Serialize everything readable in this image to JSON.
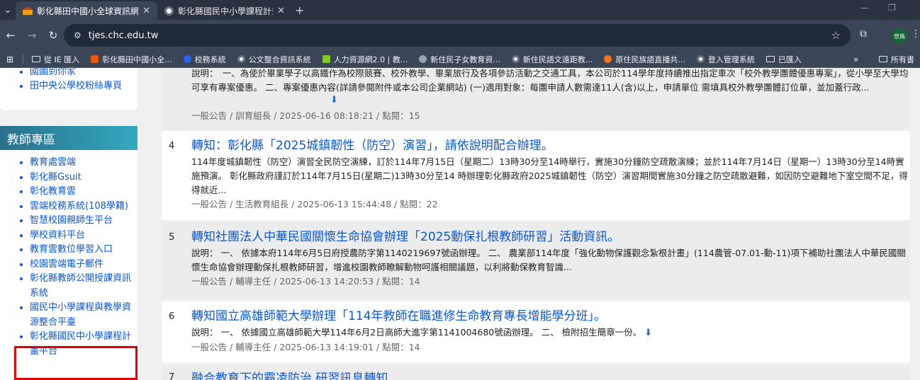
{
  "browser": {
    "tabs": [
      {
        "title": "彰化縣田中國小全球資訊網",
        "active": true
      },
      {
        "title": "彰化縣國民中小學課程計畫平台",
        "active": false
      }
    ],
    "address": "tjes.chc.edu.tw",
    "profile_label": "世鳥",
    "bookmarks": [
      "從 IE 匯入",
      "彰化縣田中國小全...",
      "校務系統",
      "公文整合資訊系統",
      "人力資源網2.0 | 教...",
      "新住民子女教育資...",
      "新住民語文遠距教...",
      "原住民族語直播共...",
      "登入管理系統",
      "已匯入"
    ],
    "bookmarks_more": "»",
    "all_bookmarks": "所有書"
  },
  "sidebar": {
    "top_items": [
      "國圖到你家",
      "田中央公學校粉絲專頁"
    ],
    "section_title": "教師專區",
    "items": [
      "教育處雲端",
      "彰化縣Gsuit",
      "彰化教育雲",
      "雲端校務系統(108學籍)",
      "智慧校園親師生平台",
      "學校資料平台",
      "教育雲數位學習入口",
      "校園雲端電子郵件",
      "彰化縣教師公開授課資訊系統",
      "國民中小學課程與教學資源整合平臺",
      "彰化縣國民中小學課程計畫平台"
    ]
  },
  "posts": [
    {
      "num": "",
      "title": "",
      "desc": "說明：　一、為使於畢業學子以高鐵作為校際競賽、校外教學、畢業旅行及各項參訪活動之交通工具，本公司於114學年度持續推出指定車次「校外教學團體優惠專案」，從小學至大學均可享有專案優惠。 二、專案優惠內容(詳請參閱附件或本公司企業網站) (一)適用對象：每團申請人數需達11人(含)以上，申請單位 需填具校外教學團體訂位單，並加蓋行政...",
      "meta": "一般公告 / 訓育組長 / 2025-06-16 08:18:21 / 點閱：15",
      "download": true
    },
    {
      "num": "4",
      "title": "轉知：彰化縣「2025城鎮韌性（防空）演習」，請依說明配合辦理。",
      "desc": "114年度城鎮韌性（防空）演習全民防空演練，訂於114年7月15日（星期二）13時30分至14時舉行，實施30分鐘防空疏散演練；並於114年7月14日（星期一）13時30分至14時實施預演。 彰化縣政府謹訂於114年7月15日(星期二)13時30分至14 時辦理彰化縣政府2025城鎮韌性（防空）演習期間實施30分鐘之防空疏散避難，如因防空避難地下室空間不足，得得就近...",
      "meta": "一般公告 / 生活教育組長 / 2025-06-13 15:44:48 / 點閱：22",
      "download": false
    },
    {
      "num": "5",
      "title": "轉知社團法人中華民國關懷生命協會辦理「2025動保扎根教師研習」活動資訊。",
      "desc": "說明：  一、 依據本府114年6月5日府授農防字第1140219697號函辦理。 二、 農業部114年度「強化動物保護觀念紮根計畫」(114農管-07.01-動-11)項下補助社團法人中華民國關懷生命協會辦理動保扎根教師研習，增進校園教師瞭解動物呵護相關議題，以利將動保教育智識...",
      "meta": "一般公告 / 輔導主任 / 2025-06-13 14:20:53 / 點閱：14",
      "download": false
    },
    {
      "num": "6",
      "title": "轉知國立高雄師範大學辦理「114年教師在職進修生命教育專長增能學分班」。",
      "desc": "說明：  一、 依據國立高雄師範大學114年6月2日高師大進字第1141004680號函辦理。 二、 檢附招生簡章一份。",
      "meta": "一般公告 / 輔導主任 / 2025-06-13 14:19:01 / 點閱：14",
      "download": true
    },
    {
      "num": "7",
      "title": "融合教育下的霸凌防治  研習訊息轉知",
      "desc": "",
      "meta": "",
      "download": false
    }
  ],
  "colors": {
    "link": "#0b57d0",
    "highlight_border": "#e00000",
    "section_header": "#2a8ca0"
  }
}
